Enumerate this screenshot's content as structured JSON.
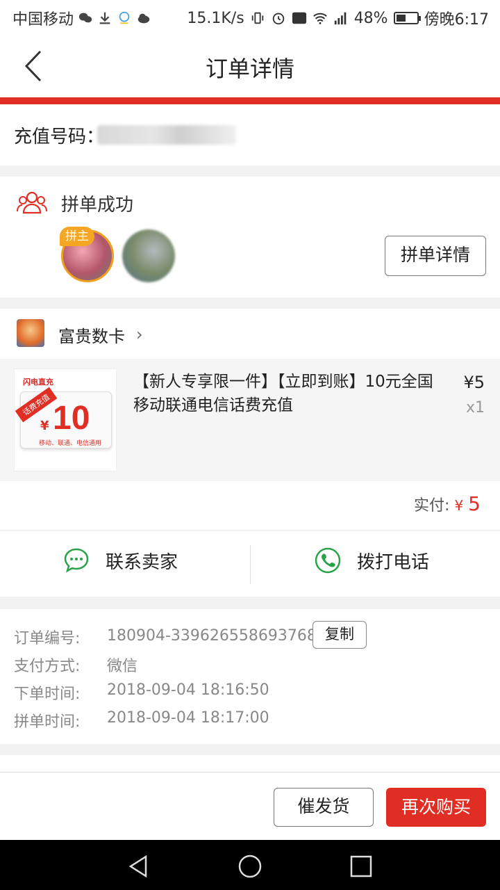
{
  "status_bar": {
    "carrier": "中国移动",
    "speed": "15.1K/s",
    "battery": "48%",
    "battery_level": 0.48,
    "time": "傍晚6:17"
  },
  "header": {
    "title": "订单详情",
    "accent_color": "#e02e24"
  },
  "recharge": {
    "label": "充值号码："
  },
  "group_buy": {
    "status": "拼单成功",
    "host_badge": "拼主",
    "detail_button": "拼单详情"
  },
  "shop": {
    "name": "富贵数卡"
  },
  "product": {
    "thumb_brand": "闪电直充",
    "thumb_ribbon": "话费充值",
    "thumb_amount": "10",
    "thumb_currency": "¥",
    "thumb_sub": "移动、联通、电信通用",
    "title": "【新人专享限一件】【立即到账】10元全国移动联通电信话费充值",
    "price": "¥5",
    "quantity": "x1"
  },
  "payment": {
    "label": "实付:",
    "currency": "¥",
    "amount": "5"
  },
  "contact": {
    "seller": "联系卖家",
    "phone": "拨打电话"
  },
  "order_info": {
    "order_no_label": "订单编号:",
    "order_no": "180904-339626558693768",
    "copy_button": "复制",
    "pay_method_label": "支付方式:",
    "pay_method": "微信",
    "order_time_label": "下单时间:",
    "order_time": "2018-09-04 18:16:50",
    "group_time_label": "拼单时间:",
    "group_time": "2018-09-04 18:17:00"
  },
  "footer": {
    "urge_button": "催发货",
    "rebuy_button": "再次购买"
  }
}
